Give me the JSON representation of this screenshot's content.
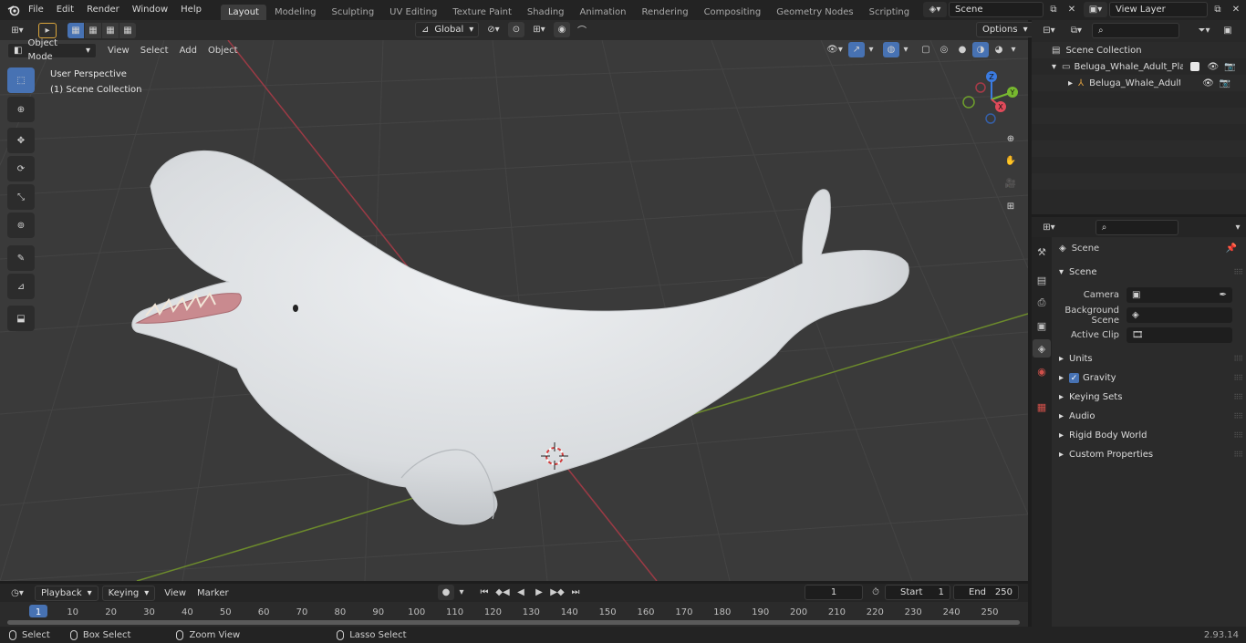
{
  "topbar": {
    "menus": [
      "File",
      "Edit",
      "Render",
      "Window",
      "Help"
    ],
    "workspaces": [
      "Layout",
      "Modeling",
      "Sculpting",
      "UV Editing",
      "Texture Paint",
      "Shading",
      "Animation",
      "Rendering",
      "Compositing",
      "Geometry Nodes",
      "Scripting"
    ],
    "active_workspace": "Layout",
    "add_tab": "+",
    "scene_name": "Scene",
    "view_layer": "View Layer"
  },
  "viewport_header": {
    "mode": "Object Mode",
    "menus": [
      "View",
      "Select",
      "Add",
      "Object"
    ],
    "transform_orientation": "Global",
    "options_label": "Options"
  },
  "viewport": {
    "perspective_label": "User Perspective",
    "collection_label": "(1) Scene Collection",
    "gizmo": {
      "z": "Z",
      "y": "Y",
      "x": "X"
    },
    "colors": {
      "bg": "#3a3a3a",
      "grid": "#444444",
      "x_axis": "#9c3a45",
      "y_axis": "#6c8a2c"
    }
  },
  "outliner": {
    "search_placeholder": "",
    "root": "Scene Collection",
    "items": [
      {
        "label": "Beluga_Whale_Adult_Playful_",
        "type": "collection"
      },
      {
        "label": "Beluga_Whale_Adult_Pla",
        "type": "armature"
      }
    ]
  },
  "properties": {
    "context": "Scene",
    "section": "Scene",
    "fields": [
      {
        "label": "Camera",
        "value": ""
      },
      {
        "label": "Background Scene",
        "value": ""
      },
      {
        "label": "Active Clip",
        "value": ""
      }
    ],
    "panels": [
      "Units",
      "Gravity",
      "Keying Sets",
      "Audio",
      "Rigid Body World",
      "Custom Properties"
    ],
    "gravity_checked": true
  },
  "timeline": {
    "menus": [
      "Playback",
      "Keying",
      "View",
      "Marker"
    ],
    "current_frame": "1",
    "start_label": "Start",
    "start_value": "1",
    "end_label": "End",
    "end_value": "250",
    "ticks": [
      "1",
      "10",
      "20",
      "30",
      "40",
      "50",
      "60",
      "70",
      "80",
      "90",
      "100",
      "110",
      "120",
      "130",
      "140",
      "150",
      "160",
      "170",
      "180",
      "190",
      "200",
      "210",
      "220",
      "230",
      "240",
      "250"
    ]
  },
  "statusbar": {
    "select": "Select",
    "box_select": "Box Select",
    "zoom_view": "Zoom View",
    "lasso_select": "Lasso Select",
    "version": "2.93.14"
  }
}
